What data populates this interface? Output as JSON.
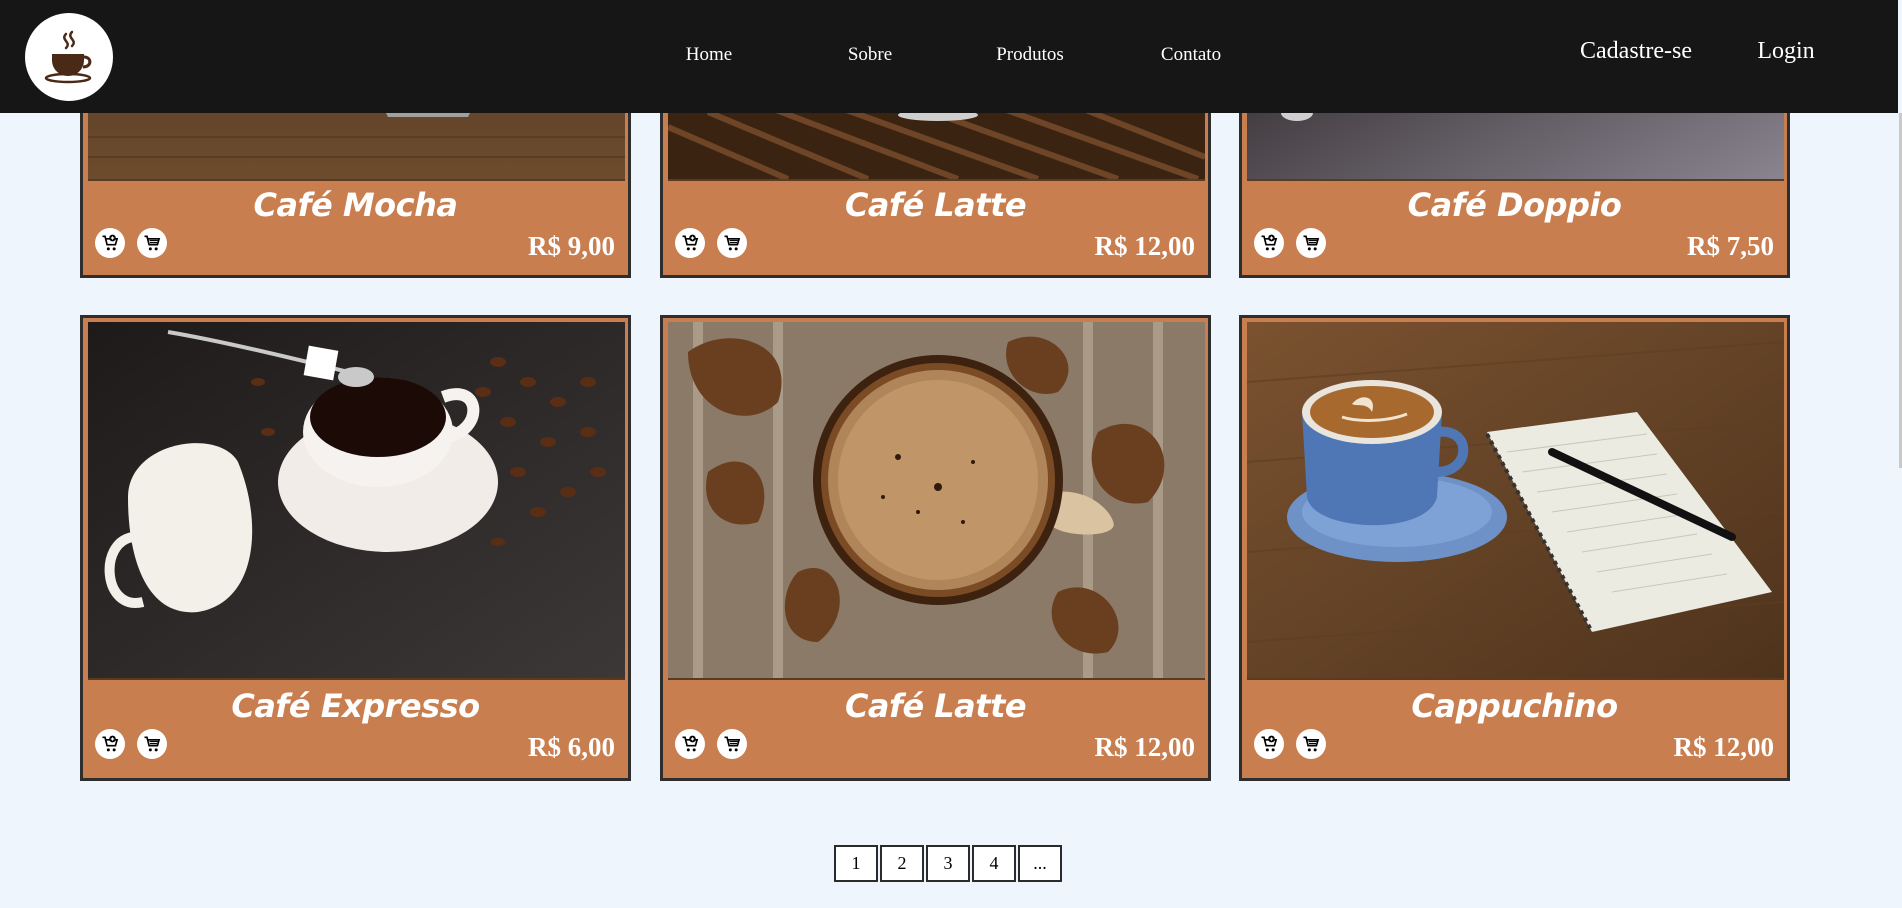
{
  "header": {
    "logo": "coffee-cup-logo",
    "nav": [
      "Home",
      "Sobre",
      "Produtos",
      "Contato"
    ],
    "signup": "Cadastre-se",
    "login": "Login"
  },
  "products_top": [
    {
      "name": "Café Mocha",
      "price": "R$ 9,00"
    },
    {
      "name": "Café Latte",
      "price": "R$ 12,00"
    },
    {
      "name": "Café Doppio",
      "price": "R$ 7,50"
    }
  ],
  "products_bottom": [
    {
      "name": "Café Expresso",
      "price": "R$ 6,00"
    },
    {
      "name": "Café Latte",
      "price": "R$ 12,00"
    },
    {
      "name": "Cappuchino",
      "price": "R$ 12,00"
    }
  ],
  "card_icons": [
    "cart-add-icon",
    "cart-icon"
  ],
  "pagination": [
    "1",
    "2",
    "3",
    "4",
    "..."
  ],
  "colors": {
    "header_bg": "#161616",
    "page_bg": "#eef5fc",
    "card_bg": "#c97e4f",
    "card_border": "#2e2e2e"
  }
}
